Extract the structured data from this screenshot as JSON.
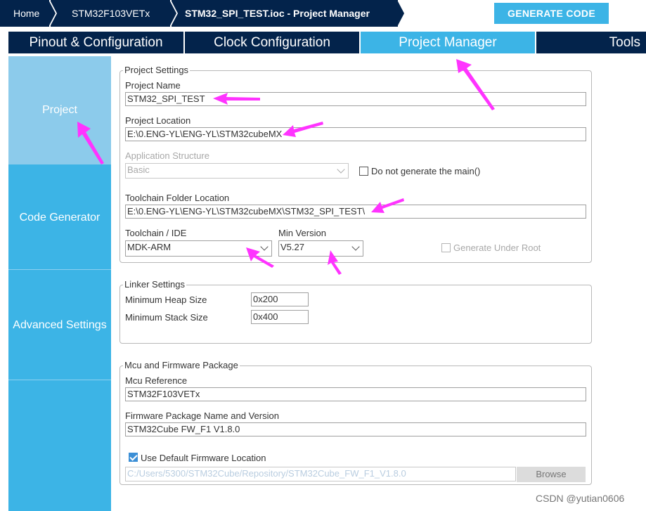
{
  "breadcrumb": {
    "home": "Home",
    "mcu": "STM32F103VETx",
    "file": "STM32_SPI_TEST.ioc - Project Manager"
  },
  "generate_button": "GENERATE CODE",
  "tabs": [
    {
      "label": "Pinout & Configuration",
      "active": false
    },
    {
      "label": "Clock Configuration",
      "active": false
    },
    {
      "label": "Project Manager",
      "active": true
    },
    {
      "label": "Tools",
      "active": false
    }
  ],
  "sidebar": {
    "items": [
      {
        "label": "Project",
        "active": true
      },
      {
        "label": "Code Generator",
        "active": false
      },
      {
        "label": "Advanced Settings",
        "active": false
      }
    ]
  },
  "project_settings": {
    "title": "Project Settings",
    "project_name_label": "Project Name",
    "project_name": "STM32_SPI_TEST",
    "project_location_label": "Project Location",
    "project_location": "E:\\0.ENG-YL\\ENG-YL\\STM32cubeMX",
    "app_structure_label": "Application Structure",
    "app_structure": "Basic",
    "no_main_label": "Do not generate the main()",
    "no_main_checked": false,
    "toolchain_folder_label": "Toolchain Folder Location",
    "toolchain_folder": "E:\\0.ENG-YL\\ENG-YL\\STM32cubeMX\\STM32_SPI_TEST\\",
    "toolchain_label": "Toolchain / IDE",
    "toolchain": "MDK-ARM",
    "min_version_label": "Min Version",
    "min_version": "V5.27",
    "generate_under_root_label": "Generate Under Root",
    "generate_under_root_checked": false
  },
  "linker_settings": {
    "title": "Linker Settings",
    "heap_label": "Minimum Heap Size",
    "heap": "0x200",
    "stack_label": "Minimum Stack Size",
    "stack": "0x400"
  },
  "mcu_firmware": {
    "title": "Mcu and Firmware Package",
    "mcu_ref_label": "Mcu Reference",
    "mcu_ref": "STM32F103VETx",
    "fw_label": "Firmware Package Name and Version",
    "fw": "STM32Cube FW_F1 V1.8.0",
    "use_default_label": "Use Default Firmware Location",
    "use_default_checked": true,
    "fw_location": "C:/Users/5300/STM32Cube/Repository/STM32Cube_FW_F1_V1.8.0",
    "browse_label": "Browse"
  },
  "watermark": "CSDN @yutian0606",
  "colors": {
    "navy": "#03234b",
    "accent": "#3cb4e6",
    "sidebar_active": "#8ccbeb",
    "annotation_arrow": "#ff33ff"
  }
}
